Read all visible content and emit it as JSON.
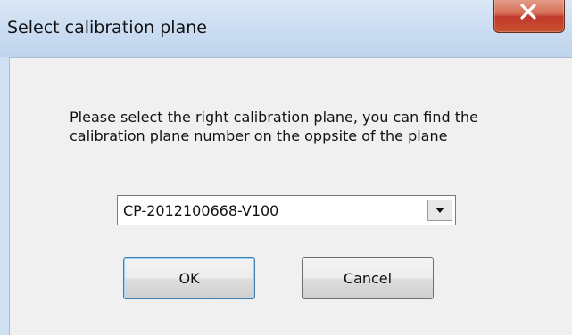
{
  "window": {
    "title": "Select calibration plane"
  },
  "dialog": {
    "message": "Please select the right calibration plane,  you can find the calibration plane number on the oppsite of the plane",
    "combo_value": "CP-2012100668-V100",
    "ok_label": "OK",
    "cancel_label": "Cancel"
  },
  "icons": {
    "close": "close-icon",
    "dropdown": "chevron-down-icon"
  },
  "colors": {
    "titlebar": "#c9dcf1",
    "close_button": "#c0392b",
    "client_background": "#f0f0f0",
    "default_button_border": "#3c7fb1"
  }
}
